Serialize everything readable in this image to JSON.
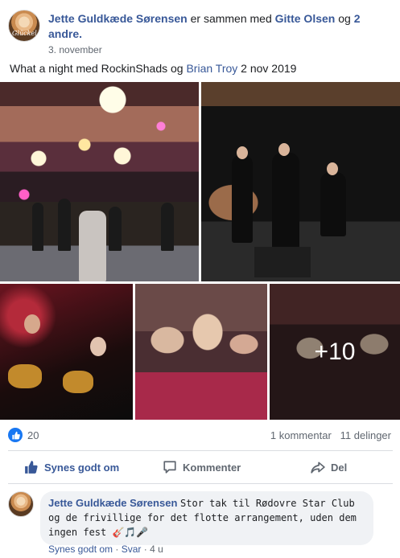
{
  "post": {
    "author": "Jette Guldkæde Sørensen",
    "with_text": "er sammen med",
    "tagged": "Gitte Olsen",
    "and_text": "og",
    "others": "2 andre.",
    "date": "3. november",
    "text_before": "What a night med RockinShads og",
    "text_link": "Brian Troy",
    "text_after": "2 nov 2019",
    "more_photos": "+10"
  },
  "reactions": {
    "like_count": "20",
    "comments": "1 kommentar",
    "shares": "11 delinger"
  },
  "actions": {
    "like": "Synes godt om",
    "comment": "Kommenter",
    "share": "Del"
  },
  "comment": {
    "author": "Jette Guldkæde Sørensen",
    "text": "Stor tak til Rødovre Star Club og de frivillige for det flotte arrangement, uden dem ingen fest 🎸🎵🎤",
    "like": "Synes godt om",
    "reply": "Svar",
    "sep": "·",
    "time": "4 u"
  },
  "colors": {
    "link": "#385898",
    "like_blue": "#1877f2",
    "bubble": "#f0f2f5"
  }
}
